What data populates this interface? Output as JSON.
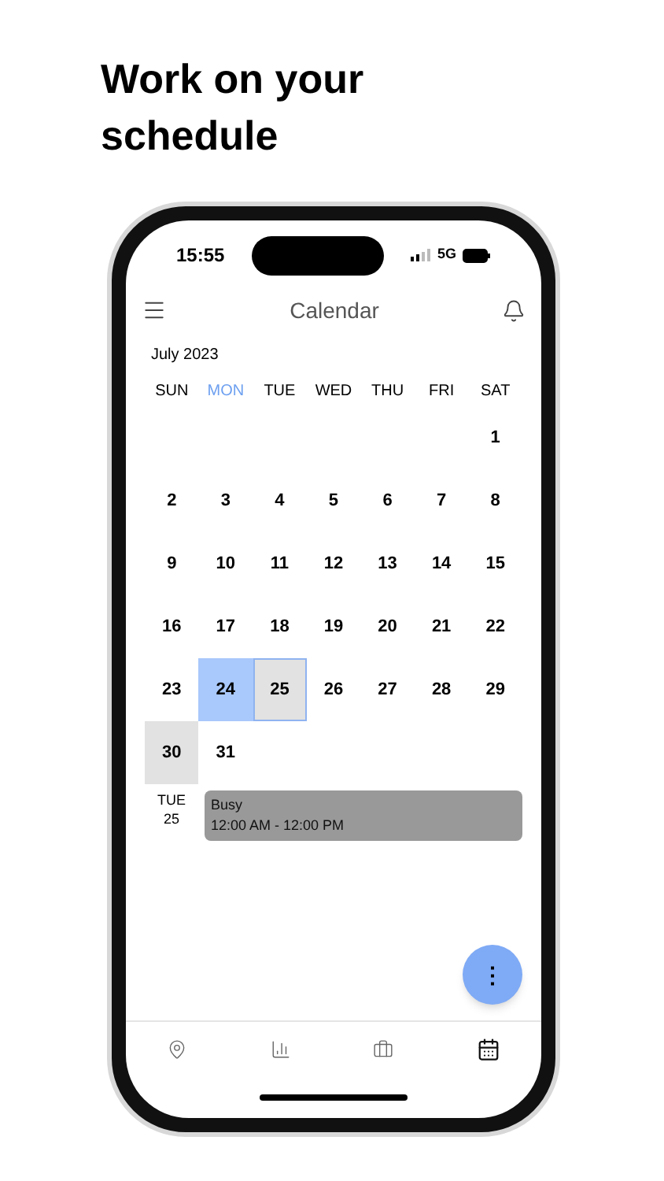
{
  "headline": "Work on your schedule",
  "status_bar": {
    "time": "15:55",
    "network": "5G"
  },
  "header": {
    "title": "Calendar"
  },
  "month": "July 2023",
  "weekdays": [
    {
      "label": "SUN",
      "highlighted": false
    },
    {
      "label": "MON",
      "highlighted": true
    },
    {
      "label": "TUE",
      "highlighted": false
    },
    {
      "label": "WED",
      "highlighted": false
    },
    {
      "label": "THU",
      "highlighted": false
    },
    {
      "label": "FRI",
      "highlighted": false
    },
    {
      "label": "SAT",
      "highlighted": false
    }
  ],
  "weeks": [
    [
      {
        "label": "1",
        "kind": "plain"
      }
    ],
    [
      {
        "label": "2",
        "kind": "plain"
      },
      {
        "label": "3",
        "kind": "plain"
      },
      {
        "label": "4",
        "kind": "plain"
      },
      {
        "label": "5",
        "kind": "plain"
      },
      {
        "label": "6",
        "kind": "plain"
      },
      {
        "label": "7",
        "kind": "plain"
      },
      {
        "label": "8",
        "kind": "plain"
      }
    ],
    [
      {
        "label": "9",
        "kind": "plain"
      },
      {
        "label": "10",
        "kind": "plain"
      },
      {
        "label": "11",
        "kind": "plain"
      },
      {
        "label": "12",
        "kind": "plain"
      },
      {
        "label": "13",
        "kind": "plain"
      },
      {
        "label": "14",
        "kind": "plain"
      },
      {
        "label": "15",
        "kind": "plain"
      }
    ],
    [
      {
        "label": "16",
        "kind": "plain"
      },
      {
        "label": "17",
        "kind": "plain"
      },
      {
        "label": "18",
        "kind": "plain"
      },
      {
        "label": "19",
        "kind": "plain"
      },
      {
        "label": "20",
        "kind": "plain"
      },
      {
        "label": "21",
        "kind": "plain"
      },
      {
        "label": "22",
        "kind": "plain"
      }
    ],
    [
      {
        "label": "23",
        "kind": "plain"
      },
      {
        "label": "24",
        "kind": "today"
      },
      {
        "label": "25",
        "kind": "selected"
      },
      {
        "label": "26",
        "kind": "plain"
      },
      {
        "label": "27",
        "kind": "plain"
      },
      {
        "label": "28",
        "kind": "plain"
      },
      {
        "label": "29",
        "kind": "plain"
      }
    ],
    [
      {
        "label": "30",
        "kind": "shaded"
      },
      {
        "label": "31",
        "kind": "plain"
      }
    ]
  ],
  "agenda": {
    "weekday": "TUE",
    "day": "25",
    "events": [
      {
        "title": "Busy",
        "time": "12:00 AM - 12:00 PM"
      }
    ]
  },
  "fab": {
    "label": "⋮"
  },
  "nav": [
    {
      "kind": "location",
      "selected": false
    },
    {
      "kind": "stats",
      "selected": false
    },
    {
      "kind": "jobs",
      "selected": false
    },
    {
      "kind": "calendar",
      "selected": true
    }
  ]
}
